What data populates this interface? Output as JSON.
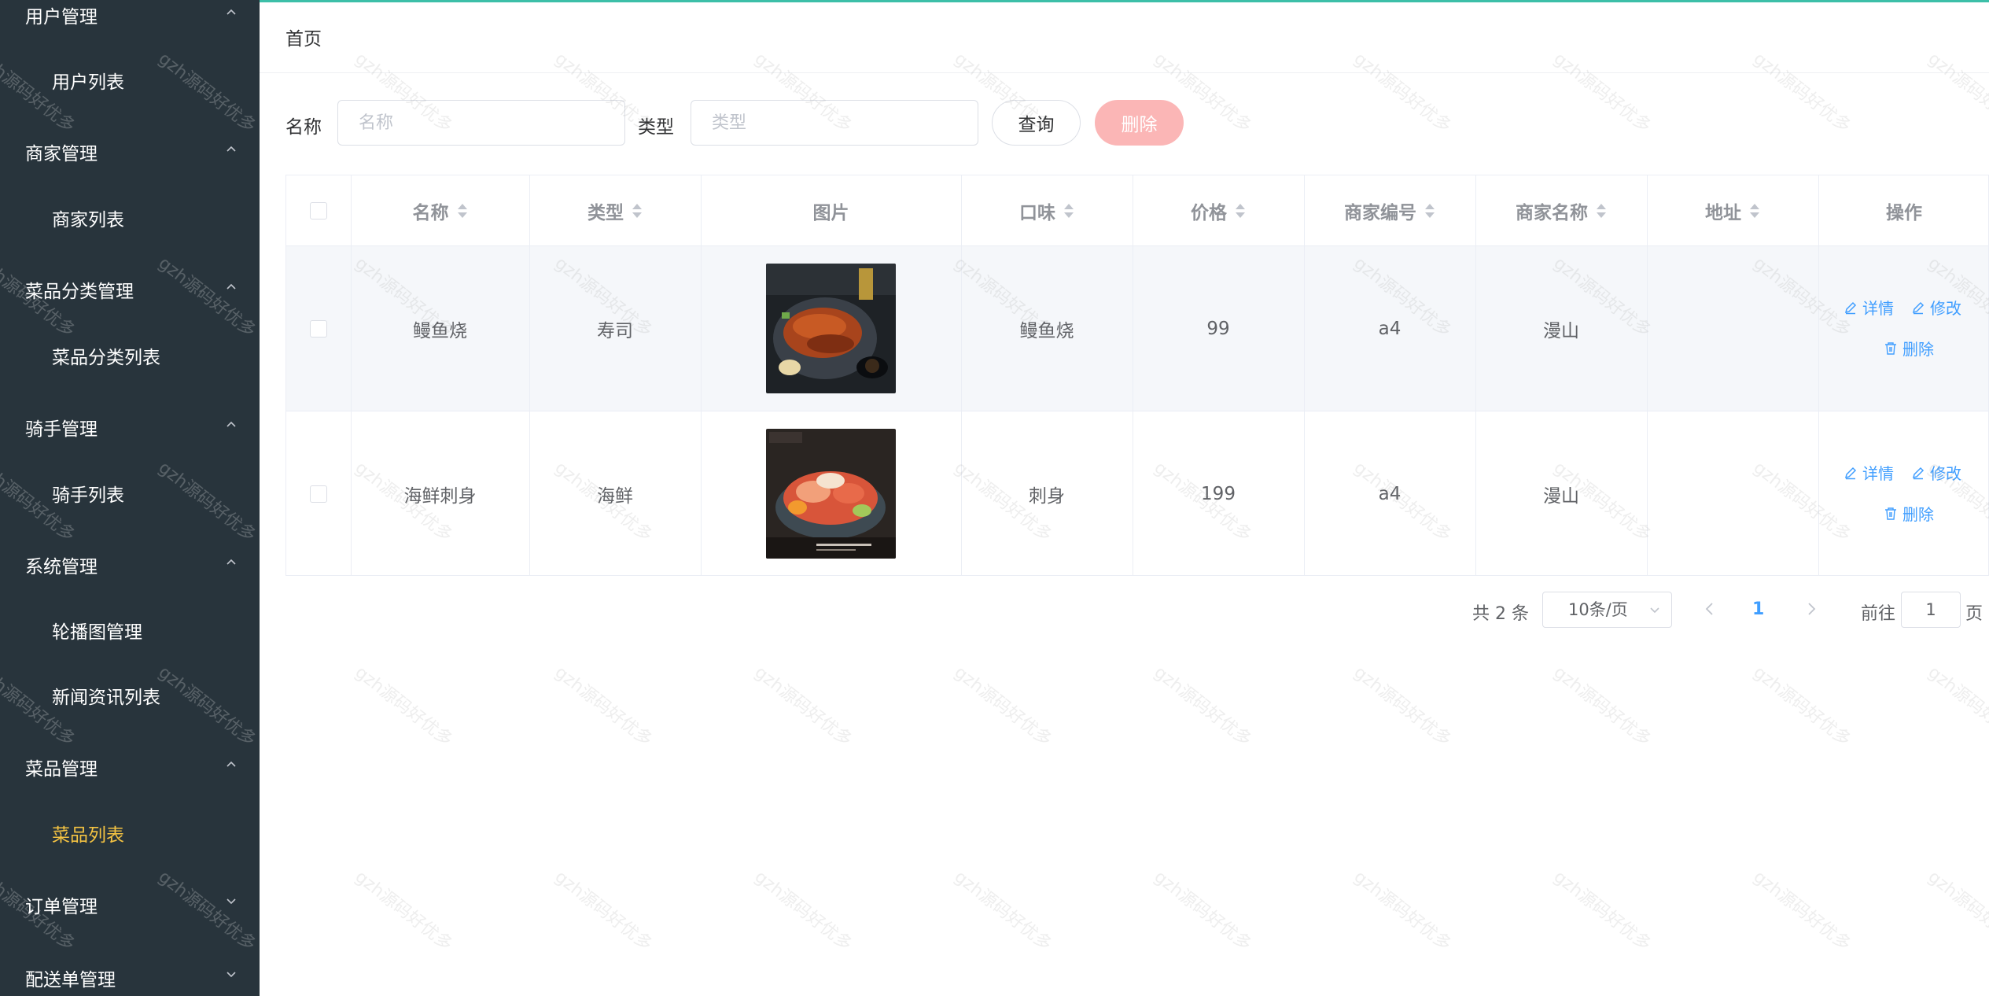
{
  "sidebar": {
    "groups": [
      {
        "title": "用户管理",
        "expanded": true,
        "items": [
          "用户列表"
        ]
      },
      {
        "title": "商家管理",
        "expanded": true,
        "items": [
          "商家列表"
        ]
      },
      {
        "title": "菜品分类管理",
        "expanded": true,
        "items": [
          "菜品分类列表"
        ]
      },
      {
        "title": "骑手管理",
        "expanded": true,
        "items": [
          "骑手列表"
        ]
      },
      {
        "title": "系统管理",
        "expanded": true,
        "items": [
          "轮播图管理",
          "新闻资讯列表"
        ]
      },
      {
        "title": "菜品管理",
        "expanded": true,
        "items": [
          "菜品列表"
        ],
        "active_item": "菜品列表"
      },
      {
        "title": "订单管理",
        "expanded": false,
        "items": []
      },
      {
        "title": "配送单管理",
        "expanded": false,
        "items": []
      }
    ]
  },
  "breadcrumb": {
    "home": "首页"
  },
  "search": {
    "name_label": "名称",
    "name_placeholder": "名称",
    "name_value": "",
    "type_label": "类型",
    "type_placeholder": "类型",
    "type_value": "",
    "query_button": "查询",
    "delete_button": "删除"
  },
  "table": {
    "columns": [
      "名称",
      "类型",
      "图片",
      "口味",
      "价格",
      "商家编号",
      "商家名称",
      "地址",
      "操作"
    ],
    "sortable": [
      true,
      true,
      false,
      true,
      true,
      true,
      true,
      true,
      false
    ],
    "rows": [
      {
        "name": "鳗鱼烧",
        "type": "寿司",
        "image": "grilled-eel-dish-photo",
        "flavor": "鳗鱼烧",
        "price": "99",
        "merchant_no": "a4",
        "merchant_name": "漫山",
        "address": ""
      },
      {
        "name": "海鲜刺身",
        "type": "海鲜",
        "image": "seafood-sashimi-platter-photo",
        "flavor": "刺身",
        "price": "199",
        "merchant_no": "a4",
        "merchant_name": "漫山",
        "address": ""
      }
    ],
    "actions": {
      "detail": "详情",
      "edit": "修改",
      "delete": "删除"
    }
  },
  "pagination": {
    "total_text": "共 2 条",
    "page_size": "10条/页",
    "current_page": "1",
    "goto_label": "前往",
    "goto_value": "1",
    "page_suffix": "页"
  },
  "watermark": "gzh源码好优多",
  "colors": {
    "sidebar_bg": "#28343c",
    "active_menu": "#f5c342",
    "link": "#409eff",
    "delete_button": "#fbb6b6",
    "top_accent": "#3dbfa8"
  }
}
